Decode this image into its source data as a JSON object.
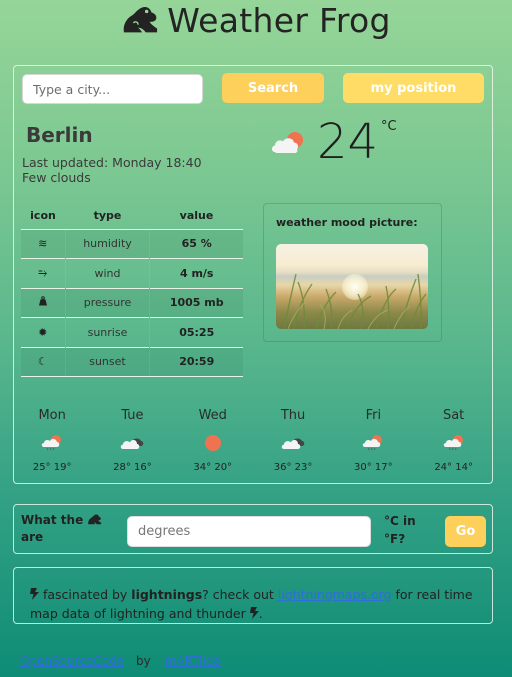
{
  "header": {
    "title": "Weather Frog",
    "logo_icon": "frog-icon"
  },
  "search": {
    "placeholder": "Type a city...",
    "value": "",
    "search_label": "Search",
    "position_label": "my position"
  },
  "current": {
    "city": "Berlin",
    "last_updated": "Last updated: Monday 18:40",
    "description": "Few clouds",
    "icon": "few-clouds-icon",
    "temperature": "24",
    "unit": "°C"
  },
  "details": {
    "headers": [
      "icon",
      "type",
      "value"
    ],
    "rows": [
      {
        "icon": "humidity-icon",
        "glyph": "≋",
        "type": "humidity",
        "value": "65 %"
      },
      {
        "icon": "wind-icon",
        "glyph": "⥱",
        "type": "wind",
        "value": "4 m/s"
      },
      {
        "icon": "pressure-weight-icon",
        "glyph": "⏏",
        "type": "pressure",
        "value": "1005 mb"
      },
      {
        "icon": "sunrise-sun-icon",
        "glyph": "✹",
        "type": "sunrise",
        "value": "05:25"
      },
      {
        "icon": "sunset-moon-icon",
        "glyph": "☾",
        "type": "sunset",
        "value": "20:59"
      }
    ]
  },
  "mood": {
    "title": "weather mood picture:",
    "image": "beach-grass-sunset-picture"
  },
  "forecast": [
    {
      "day": "Mon",
      "icon": "rain-sun-icon",
      "temps": "25° 19°"
    },
    {
      "day": "Tue",
      "icon": "broken-clouds-icon",
      "temps": "28° 16°"
    },
    {
      "day": "Wed",
      "icon": "sun-icon",
      "temps": "34° 20°"
    },
    {
      "day": "Thu",
      "icon": "broken-clouds-icon",
      "temps": "36° 23°"
    },
    {
      "day": "Fri",
      "icon": "rain-sun-icon",
      "temps": "30° 17°"
    },
    {
      "day": "Sat",
      "icon": "rain-sun-icon",
      "temps": "24° 14°"
    }
  ],
  "converter": {
    "label_pre": "What the",
    "label_post": "are",
    "placeholder": "degrees",
    "unit_text_1": "°C in",
    "unit_text_2": "°F?",
    "go_label": "Go"
  },
  "lightning": {
    "part1": " fascinated by ",
    "bold": "lightnings",
    "part2": "? check out ",
    "link_text": "lightningmaps.org",
    "part3": " for real time map data of lightning and thunder ",
    "part4": "."
  },
  "footer": {
    "source_link": "OpenSourceCode",
    "by": "by",
    "author_link": "mARTilda"
  },
  "colors": {
    "bg_top": "#96d598",
    "bg_bottom": "#0e8c75",
    "button_yellow": "#fdd05b",
    "button_yellow_light": "#ffdc66",
    "sun_orange": "#ef7350",
    "link_blue": "#2d6fd6"
  }
}
